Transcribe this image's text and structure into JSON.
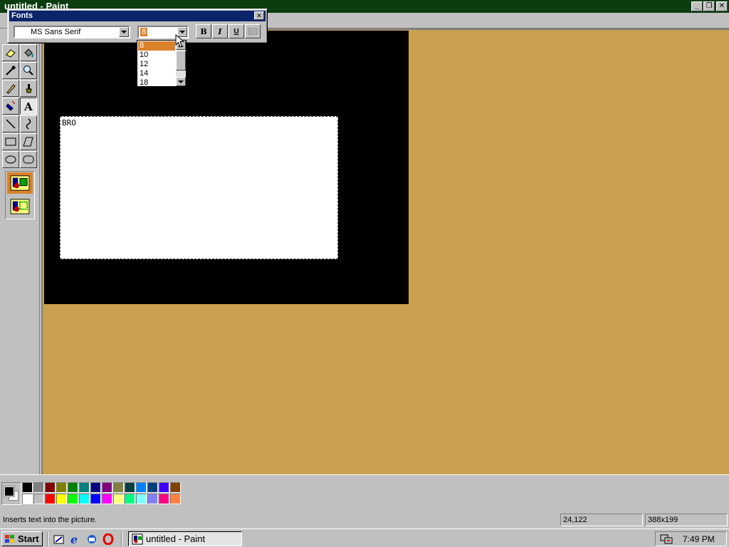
{
  "window": {
    "title": "untitled - Paint",
    "minimize_glyph": "_",
    "restore_glyph": "❐",
    "close_glyph": "✕"
  },
  "fonts_toolbar": {
    "title": "Fonts",
    "close_glyph": "✕",
    "font_name": "MS Sans Serif",
    "font_size": "8",
    "bold_label": "B",
    "italic_label": "I",
    "underline_label": "U",
    "size_options": [
      "8",
      "10",
      "12",
      "14",
      "18"
    ],
    "selected_size_index": 0
  },
  "canvas": {
    "text_content": "BRO",
    "background_color": "#000000",
    "text_area_color": "#ffffff"
  },
  "workspace_color": "#c9a050",
  "tools": [
    {
      "name": "eraser-icon"
    },
    {
      "name": "fill-icon"
    },
    {
      "name": "color-picker-icon"
    },
    {
      "name": "magnifier-icon"
    },
    {
      "name": "pencil-icon"
    },
    {
      "name": "brush-icon"
    },
    {
      "name": "airbrush-icon"
    },
    {
      "name": "text-icon"
    },
    {
      "name": "line-icon"
    },
    {
      "name": "curve-icon"
    },
    {
      "name": "rectangle-icon"
    },
    {
      "name": "polygon-icon"
    },
    {
      "name": "ellipse-icon"
    },
    {
      "name": "rounded-rectangle-icon"
    }
  ],
  "palette": {
    "top_row": [
      "#000000",
      "#808080",
      "#800000",
      "#808000",
      "#008000",
      "#008080",
      "#000080",
      "#800080",
      "#808040",
      "#004040",
      "#0080ff",
      "#004080",
      "#4000ff",
      "#804000"
    ],
    "bottom_row": [
      "#ffffff",
      "#c0c0c0",
      "#ff0000",
      "#ffff00",
      "#00ff00",
      "#00ffff",
      "#0000ff",
      "#ff00ff",
      "#ffff80",
      "#00ff80",
      "#80ffff",
      "#8080ff",
      "#ff0080",
      "#ff8040"
    ],
    "foreground": "#000000",
    "background": "#ffffff"
  },
  "status": {
    "message": "Inserts text into the picture.",
    "coords": "24,122",
    "selection_size": "388x199"
  },
  "taskbar": {
    "start_label": "Start",
    "task_label": "untitled - Paint",
    "clock": "7:49 PM"
  }
}
